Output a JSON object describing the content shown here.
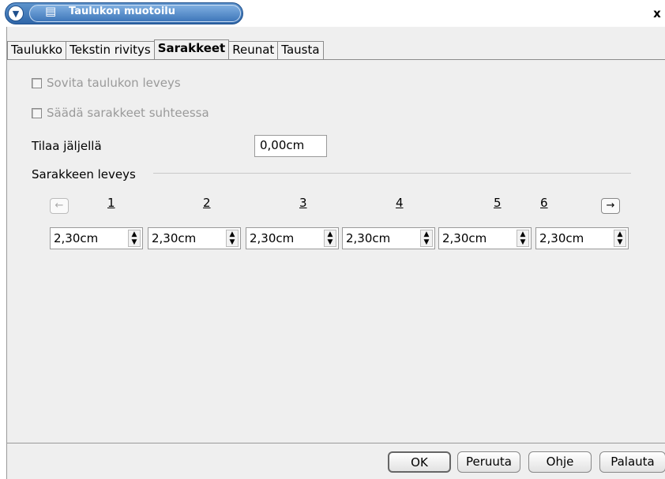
{
  "window": {
    "title": "Taulukon muotoilu",
    "close_label": "x"
  },
  "tabs": [
    {
      "label": "Taulukko"
    },
    {
      "label": "Tekstin rivitys"
    },
    {
      "label": "Sarakkeet"
    },
    {
      "label": "Reunat"
    },
    {
      "label": "Tausta"
    }
  ],
  "options": {
    "fit_width": {
      "label": "Sovita taulukon leveys",
      "checked": false,
      "enabled": false
    },
    "adjust_proportional": {
      "label": "Säädä sarakkeet suhteessa",
      "checked": false,
      "enabled": false
    }
  },
  "remaining": {
    "label": "Tilaa jäljellä",
    "value": "0,00cm"
  },
  "column_width": {
    "section_label": "Sarakkeen leveys",
    "nav_left": "←",
    "nav_right": "→",
    "columns": [
      {
        "number": "1",
        "value": "2,30cm"
      },
      {
        "number": "2",
        "value": "2,30cm"
      },
      {
        "number": "3",
        "value": "2,30cm"
      },
      {
        "number": "4",
        "value": "2,30cm"
      },
      {
        "number": "5",
        "value": "2,30cm"
      },
      {
        "number": "6",
        "value": "2,30cm"
      }
    ]
  },
  "buttons": {
    "ok": "OK",
    "cancel": "Peruuta",
    "help": "Ohje",
    "reset": "Palauta"
  }
}
